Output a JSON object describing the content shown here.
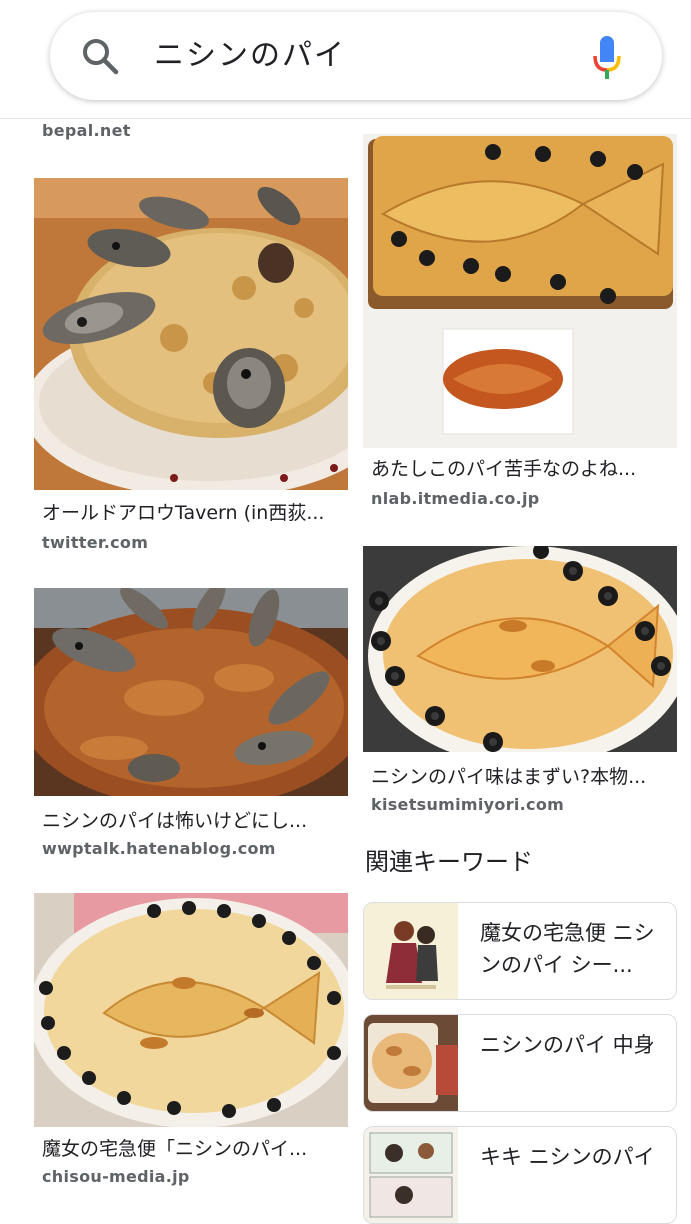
{
  "search": {
    "query": "ニシンのパイ"
  },
  "results_left": [
    {
      "title": "",
      "source": "bepal.net"
    },
    {
      "title": "オールドアロウTavern (in西荻...",
      "source": "twitter.com"
    },
    {
      "title": "ニシンのパイは怖いけどにし...",
      "source": "wwptalk.hatenablog.com"
    },
    {
      "title": "魔女の宅急便「ニシンのパイ...",
      "source": "chisou-media.jp"
    }
  ],
  "results_right": [
    {
      "title": "あたしこのパイ苦手なのよね...",
      "source": "nlab.itmedia.co.jp"
    },
    {
      "title": "ニシンのパイ味はまずい?本物...",
      "source": "kisetsumimiyori.com"
    }
  ],
  "related": {
    "heading": "関連キーワード",
    "items": [
      {
        "label": "魔女の宅急便 ニシンのパイ シー..."
      },
      {
        "label": "ニシンのパイ 中身"
      },
      {
        "label": "キキ ニシンのパイ"
      }
    ]
  },
  "colors": {
    "accent_blue": "#4285f4",
    "mic_red": "#ea4335",
    "mic_yellow": "#fbbc05",
    "mic_green": "#34a853"
  }
}
